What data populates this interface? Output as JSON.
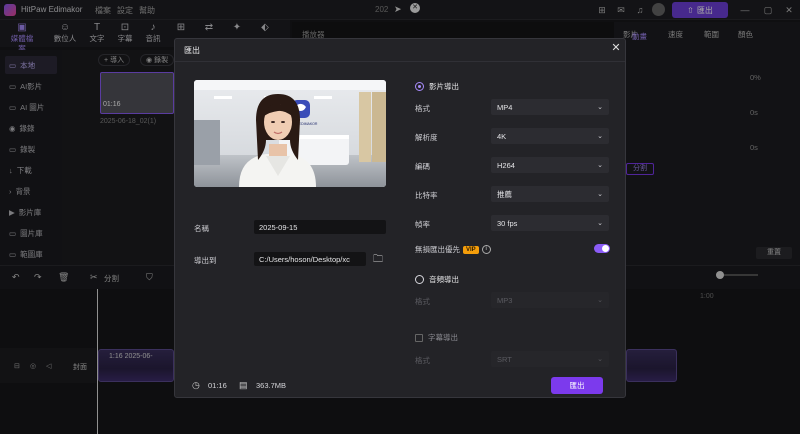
{
  "app": {
    "title": "HitPaw Edimakor",
    "menu": [
      "檔案",
      "設定",
      "幫助"
    ],
    "project_name": "202",
    "export_button": "匯出"
  },
  "toolbar": {
    "tools": [
      {
        "label": "媒體檔案",
        "icon": "media-icon"
      },
      {
        "label": "數位人",
        "icon": "avatar-icon"
      },
      {
        "label": "文字",
        "icon": "text-icon"
      },
      {
        "label": "字幕",
        "icon": "subtitle-icon"
      },
      {
        "label": "音訊",
        "icon": "audio-icon"
      }
    ]
  },
  "sidebar": {
    "items": [
      {
        "label": "本地"
      },
      {
        "label": "AI影片"
      },
      {
        "label": "AI 圖片"
      },
      {
        "label": "錄錄"
      },
      {
        "label": "錄製"
      },
      {
        "label": "下載"
      },
      {
        "label": "背景"
      },
      {
        "label": "影片庫"
      },
      {
        "label": "圖片庫"
      },
      {
        "label": "範圖庫"
      }
    ]
  },
  "media_panel": {
    "import_label": "導入",
    "record_label": "錄製",
    "clip_date": "2025-06-18_02(1)",
    "clip_duration": "01:16"
  },
  "player": {
    "title": "播放器"
  },
  "right_panel": {
    "tabs": [
      "影片",
      "動畫",
      "速度",
      "範圍",
      "顏色"
    ],
    "values": [
      "0%",
      "0s",
      "0s"
    ],
    "split_label": "分割",
    "reset_label": "重置"
  },
  "timeline": {
    "split_label": "分割",
    "ruler_mark": "1:00",
    "track_label": "封面",
    "clip_label": "1:16  2025-06-"
  },
  "dialog": {
    "title": "匯出",
    "name_label": "名稱",
    "name_value": "2025-09-15",
    "export_to_label": "導出到",
    "export_path": "C:/Users/hoson/Desktop/xc",
    "video_section": "影片導出",
    "audio_section": "音頻導出",
    "subtitle_section": "字幕導出",
    "settings": [
      {
        "label": "格式",
        "value": "MP4"
      },
      {
        "label": "解析度",
        "value": "4K"
      },
      {
        "label": "編碼",
        "value": "H264"
      },
      {
        "label": "比特率",
        "value": "推薦"
      },
      {
        "label": "幀率",
        "value": "30  fps"
      }
    ],
    "lossless_label": "無損匯出優先",
    "vip_badge": "VIP",
    "audio_format_label": "格式",
    "audio_format_value": "MP3",
    "subtitle_format_label": "格式",
    "subtitle_format_value": "SRT",
    "duration": "01:16",
    "file_size": "363.7MB",
    "export_button": "匯出",
    "thumbnail_logo_text": "HITPAW EDIMAKOR"
  },
  "colors": {
    "accent": "#7c3aed",
    "accent_light": "#a78bfa",
    "vip": "#f59e0b"
  }
}
